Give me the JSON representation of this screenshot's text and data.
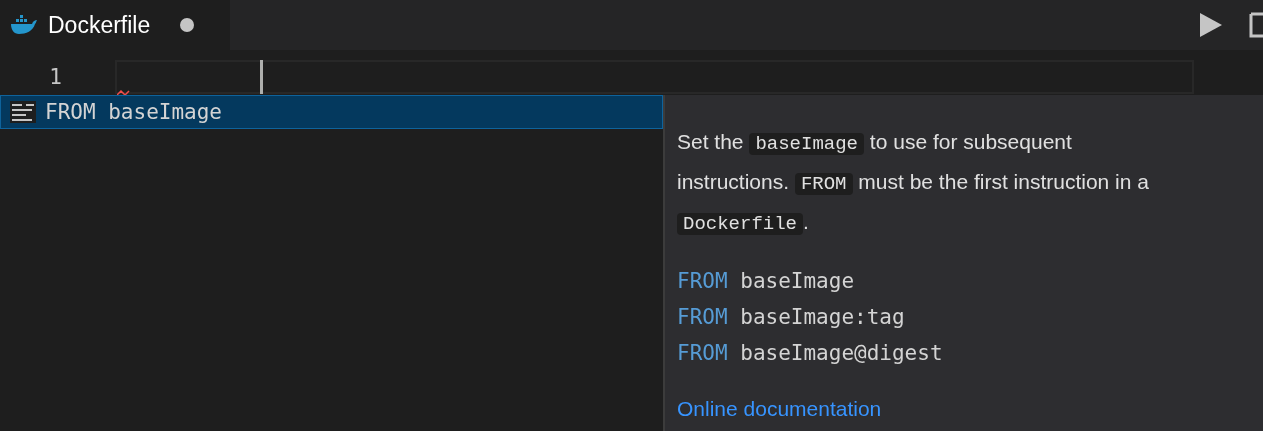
{
  "tab": {
    "title": "Dockerfile",
    "dirty": true,
    "selected": true
  },
  "toolbar": {
    "run_enabled": true
  },
  "editor": {
    "line_number": "1",
    "error": true
  },
  "suggestions": [
    {
      "label": "FROM baseImage",
      "selected": true
    }
  ],
  "docs": {
    "paragraph": [
      [
        {
          "text": "Set the ",
          "code": false
        },
        {
          "text": "baseImage",
          "code": true
        },
        {
          "text": " to use for subsequent",
          "code": false
        }
      ],
      [
        {
          "text": "instructions. ",
          "code": false
        },
        {
          "text": "FROM",
          "code": true
        },
        {
          "text": " must be the first instruction in a",
          "code": false
        }
      ],
      [
        {
          "text": "Dockerfile",
          "code": true
        },
        {
          "text": ".",
          "code": false
        }
      ]
    ],
    "examples": [
      {
        "keyword": "FROM",
        "arg": "baseImage"
      },
      {
        "keyword": "FROM",
        "arg": "baseImage:tag"
      },
      {
        "keyword": "FROM",
        "arg": "baseImage@digest"
      }
    ],
    "link": "Online documentation"
  }
}
